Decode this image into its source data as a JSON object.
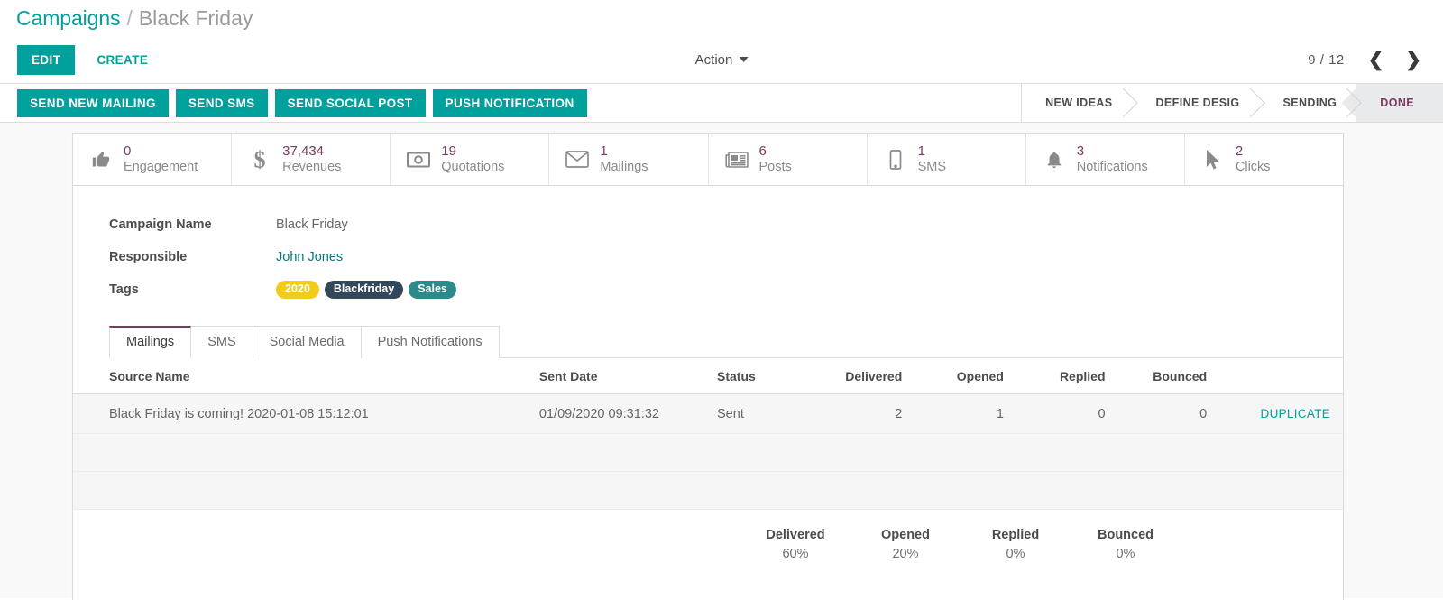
{
  "breadcrumb": {
    "root": "Campaigns",
    "separator": "/",
    "current": "Black Friday"
  },
  "control_panel": {
    "edit_label": "EDIT",
    "create_label": "CREATE",
    "action_label": "Action",
    "pager_count": "9 / 12",
    "prev_icon": "chevron-left-icon",
    "next_icon": "chevron-right-icon"
  },
  "action_buttons": [
    {
      "label": "SEND NEW MAILING"
    },
    {
      "label": "SEND SMS"
    },
    {
      "label": "SEND SOCIAL POST"
    },
    {
      "label": "PUSH NOTIFICATION"
    }
  ],
  "statusbar": {
    "stages": [
      {
        "label": "NEW IDEAS",
        "active": false
      },
      {
        "label": "DEFINE DESIG",
        "active": false
      },
      {
        "label": "SENDING",
        "active": false
      },
      {
        "label": "DONE",
        "active": true
      }
    ],
    "active_color": "#7c3b5e"
  },
  "stat_buttons": [
    {
      "icon": "thumbs-up-icon",
      "value": "0",
      "label": "Engagement"
    },
    {
      "icon": "dollar-sign-icon",
      "value": "37,434",
      "label": "Revenues"
    },
    {
      "icon": "money-bill-icon",
      "value": "19",
      "label": "Quotations"
    },
    {
      "icon": "envelope-icon",
      "value": "1",
      "label": "Mailings"
    },
    {
      "icon": "newspaper-icon",
      "value": "6",
      "label": "Posts"
    },
    {
      "icon": "mobile-phone-icon",
      "value": "1",
      "label": "SMS"
    },
    {
      "icon": "bell-icon",
      "value": "3",
      "label": "Notifications"
    },
    {
      "icon": "mouse-pointer-icon",
      "value": "2",
      "label": "Clicks"
    }
  ],
  "form": {
    "campaign_name_label": "Campaign Name",
    "campaign_name_value": "Black Friday",
    "responsible_label": "Responsible",
    "responsible_value": "John Jones",
    "tags_label": "Tags",
    "tags": [
      {
        "label": "2020",
        "color": "#f2cb1d"
      },
      {
        "label": "Blackfriday",
        "color": "#33475b"
      },
      {
        "label": "Sales",
        "color": "#2d8a8a"
      }
    ]
  },
  "tabs": [
    {
      "label": "Mailings",
      "active": true
    },
    {
      "label": "SMS",
      "active": false
    },
    {
      "label": "Social Media",
      "active": false
    },
    {
      "label": "Push Notifications",
      "active": false
    }
  ],
  "table": {
    "columns": [
      "Source Name",
      "Sent Date",
      "Status",
      "Delivered",
      "Opened",
      "Replied",
      "Bounced"
    ],
    "rows": [
      {
        "source_name": "Black Friday is coming! 2020-01-08 15:12:01",
        "sent_date": "01/09/2020 09:31:32",
        "status": "Sent",
        "delivered": "2",
        "opened": "1",
        "replied": "0",
        "bounced": "0",
        "duplicate_label": "DUPLICATE"
      }
    ]
  },
  "summary": [
    {
      "label": "Delivered",
      "value": "60%"
    },
    {
      "label": "Opened",
      "value": "20%"
    },
    {
      "label": "Replied",
      "value": "0%"
    },
    {
      "label": "Bounced",
      "value": "0%"
    }
  ],
  "theme": {
    "accent": "#00a09d",
    "stat_value_color": "#7c3b5e",
    "breadcrumb_root_color": "#00a09d"
  }
}
